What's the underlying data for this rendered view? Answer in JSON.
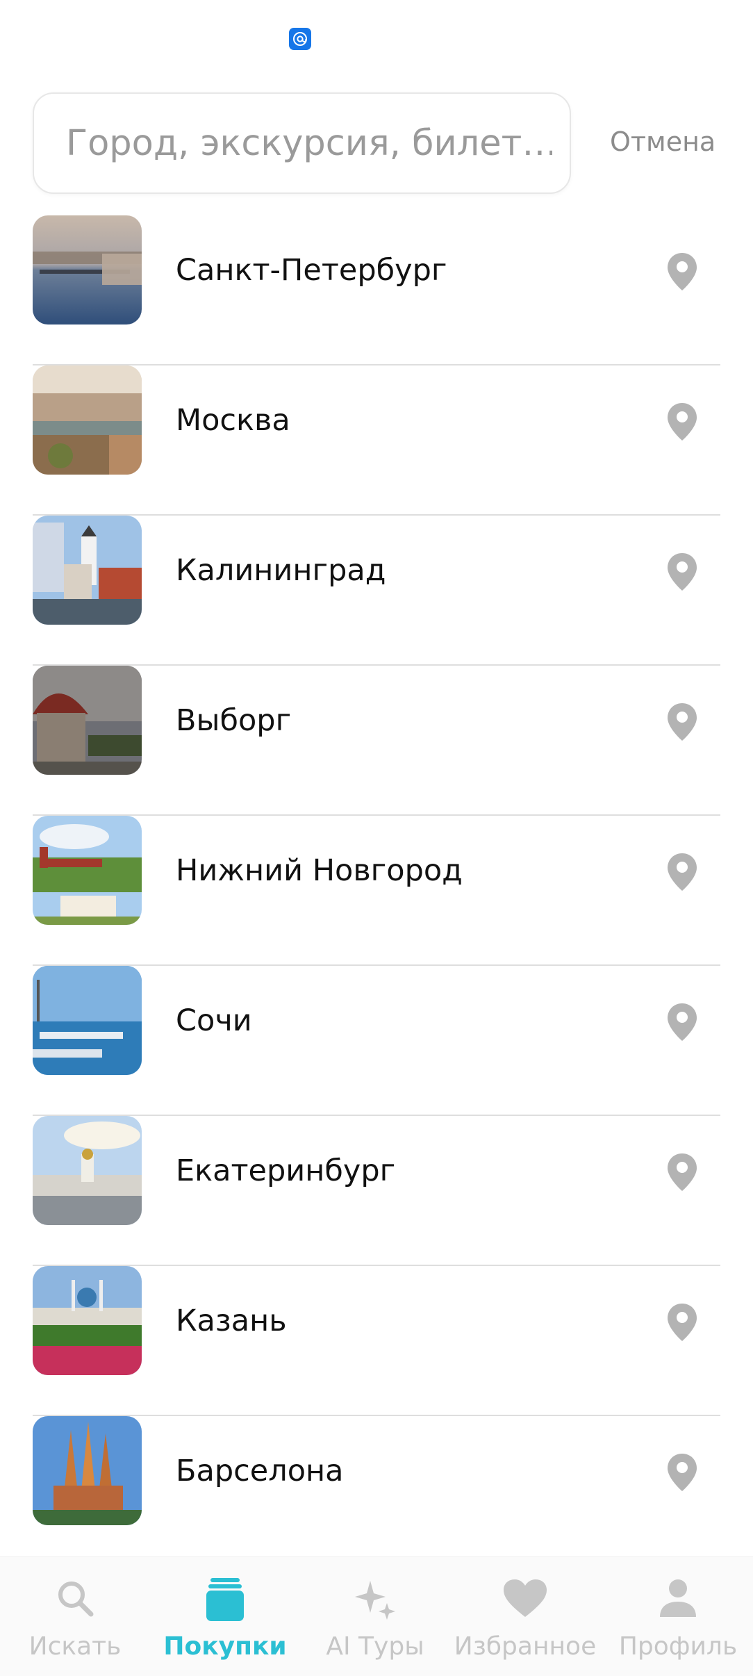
{
  "status_bar": {
    "notification_icon": "at-sign-icon"
  },
  "search": {
    "placeholder": "Город, экскурсия, билет…",
    "value": "",
    "cancel_label": "Отмена"
  },
  "cities": [
    {
      "name": "Санкт-Петербург",
      "thumb": "spb"
    },
    {
      "name": "Москва",
      "thumb": "moscow"
    },
    {
      "name": "Калининград",
      "thumb": "kaliningrad"
    },
    {
      "name": "Выборг",
      "thumb": "vyborg"
    },
    {
      "name": "Нижний Новгород",
      "thumb": "nn"
    },
    {
      "name": "Сочи",
      "thumb": "sochi"
    },
    {
      "name": "Екатеринбург",
      "thumb": "ekb"
    },
    {
      "name": "Казань",
      "thumb": "kazan"
    },
    {
      "name": "Барселона",
      "thumb": "barcelona"
    }
  ],
  "bottom_nav": [
    {
      "label": "Искать",
      "icon": "search-icon",
      "active": false
    },
    {
      "label": "Покупки",
      "icon": "purchases-icon",
      "active": true
    },
    {
      "label": "AI Туры",
      "icon": "sparkles-icon",
      "active": false
    },
    {
      "label": "Избранное",
      "icon": "heart-icon",
      "active": false
    },
    {
      "label": "Профиль",
      "icon": "profile-icon",
      "active": false
    }
  ],
  "colors": {
    "accent": "#2bbfd3",
    "inactive_nav": "#c6c6c6",
    "pin": "#b3b3b3",
    "notification": "#1676e8"
  }
}
